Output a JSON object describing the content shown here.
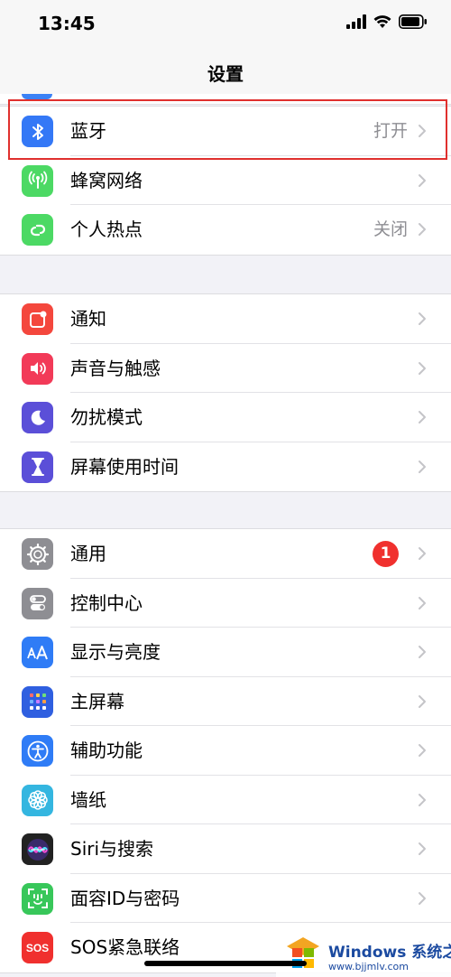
{
  "status_bar": {
    "time": "13:45"
  },
  "nav": {
    "title": "设置"
  },
  "group1": [
    {
      "label": "蓝牙",
      "value": "打开",
      "icon": "bluetooth-icon",
      "color": "#3478f6"
    },
    {
      "label": "蜂窝网络",
      "value": "",
      "icon": "cellular-icon",
      "color": "#4cd964"
    },
    {
      "label": "个人热点",
      "value": "关闭",
      "icon": "hotspot-icon",
      "color": "#4cd964"
    }
  ],
  "group2": [
    {
      "label": "通知",
      "icon": "notifications-icon",
      "color": "#f4473d"
    },
    {
      "label": "声音与触感",
      "icon": "sound-icon",
      "color": "#f23a58"
    },
    {
      "label": "勿扰模式",
      "icon": "moon-icon",
      "color": "#5b4fd8"
    },
    {
      "label": "屏幕使用时间",
      "icon": "hourglass-icon",
      "color": "#5b4fd8"
    }
  ],
  "group3": [
    {
      "label": "通用",
      "badge": "1",
      "icon": "gear-icon",
      "color": "#8e8e93"
    },
    {
      "label": "控制中心",
      "icon": "toggles-icon",
      "color": "#8e8e93"
    },
    {
      "label": "显示与亮度",
      "icon": "text-size-icon",
      "color": "#2f7cf6"
    },
    {
      "label": "主屏幕",
      "icon": "home-screen-icon",
      "color": "#2f5fe0"
    },
    {
      "label": "辅助功能",
      "icon": "accessibility-icon",
      "color": "#2f7cf6"
    },
    {
      "label": "墙纸",
      "icon": "wallpaper-icon",
      "color": "#34b6e0"
    },
    {
      "label": "Siri与搜索",
      "icon": "siri-icon",
      "color": "#222222"
    },
    {
      "label": "面容ID与密码",
      "icon": "face-id-icon",
      "color": "#38c75a"
    },
    {
      "label": "SOS紧急联络",
      "icon": "sos-icon",
      "color": "#f0302e",
      "icon_text": "SOS"
    }
  ],
  "watermark": {
    "title": "Windows 系统之家",
    "url": "www.bjjmlv.com"
  }
}
